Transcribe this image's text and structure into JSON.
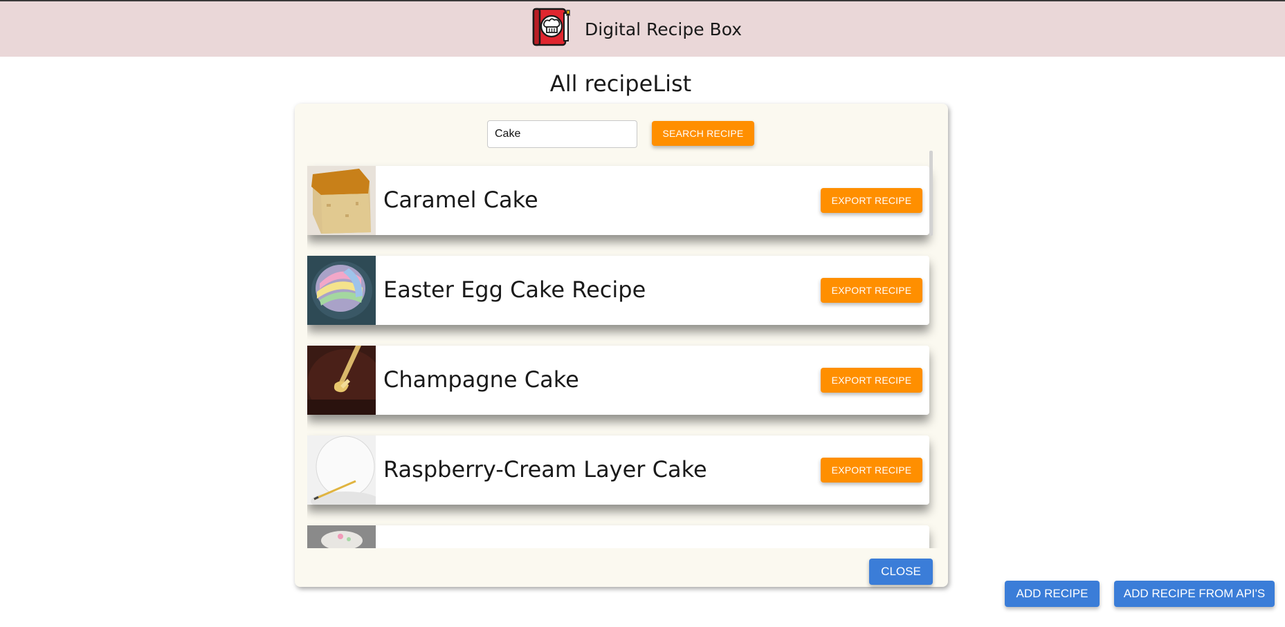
{
  "header": {
    "title": "Digital Recipe Box",
    "logo_icon": "recipe-book-icon",
    "background": "#ead7d8"
  },
  "page": {
    "title": "All recipeList"
  },
  "search": {
    "value": "Cake",
    "button_label": "SEARCH RECIPE"
  },
  "recipes": [
    {
      "title": "Caramel Cake",
      "export_label": "EXPORT RECIPE",
      "thumb": "caramel-cake-photo"
    },
    {
      "title": "Easter Egg Cake Recipe",
      "export_label": "EXPORT RECIPE",
      "thumb": "easter-egg-cake-photo"
    },
    {
      "title": "Champagne Cake",
      "export_label": "EXPORT RECIPE",
      "thumb": "champagne-cake-photo"
    },
    {
      "title": "Raspberry-Cream Layer Cake",
      "export_label": "EXPORT RECIPE",
      "thumb": "raspberry-cake-photo"
    },
    {
      "title": "",
      "export_label": "",
      "thumb": "partial-cake-photo"
    }
  ],
  "modal": {
    "close_label": "CLOSE"
  },
  "actions": {
    "add_label": "ADD RECIPE",
    "add_api_label": "ADD RECIPE FROM API'S"
  },
  "colors": {
    "accent_orange": "#ff8f00",
    "accent_blue": "#3b7dd8",
    "modal_bg": "#fbf9f0"
  }
}
